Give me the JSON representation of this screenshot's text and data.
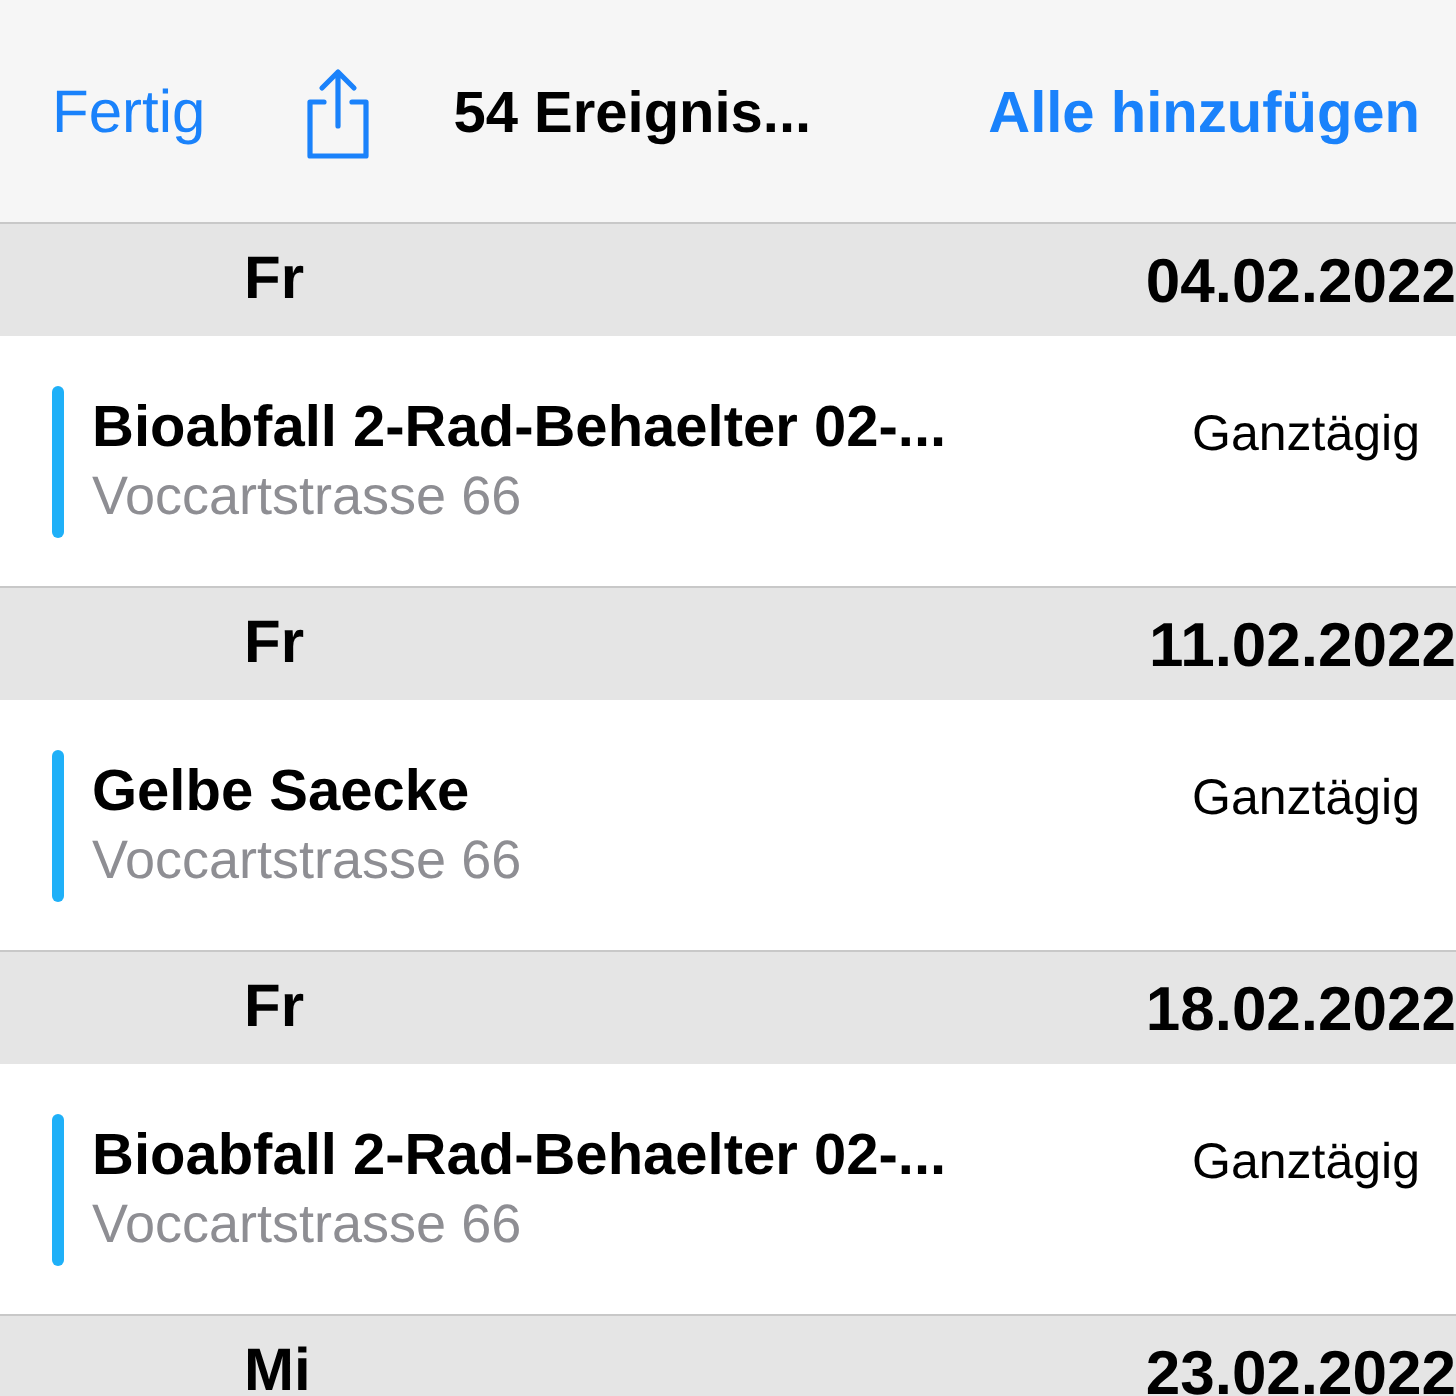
{
  "toolbar": {
    "done": "Fertig",
    "title": "54 Ereignis...",
    "add_all": "Alle hinzufügen"
  },
  "days": [
    {
      "weekday": "Fr",
      "date": "04.02.2022",
      "events": [
        {
          "title": "Bioabfall 2-Rad-Behaelter 02-...",
          "location": "Voccartstrasse 66",
          "time": "Ganztägig",
          "color": "#1fb0f8"
        }
      ]
    },
    {
      "weekday": "Fr",
      "date": "11.02.2022",
      "events": [
        {
          "title": "Gelbe Saecke",
          "location": "Voccartstrasse 66",
          "time": "Ganztägig",
          "color": "#1fb0f8"
        }
      ]
    },
    {
      "weekday": "Fr",
      "date": "18.02.2022",
      "events": [
        {
          "title": "Bioabfall 2-Rad-Behaelter 02-...",
          "location": "Voccartstrasse 66",
          "time": "Ganztägig",
          "color": "#1fb0f8"
        }
      ]
    },
    {
      "weekday": "Mi",
      "date": "23.02.2022"
    }
  ]
}
